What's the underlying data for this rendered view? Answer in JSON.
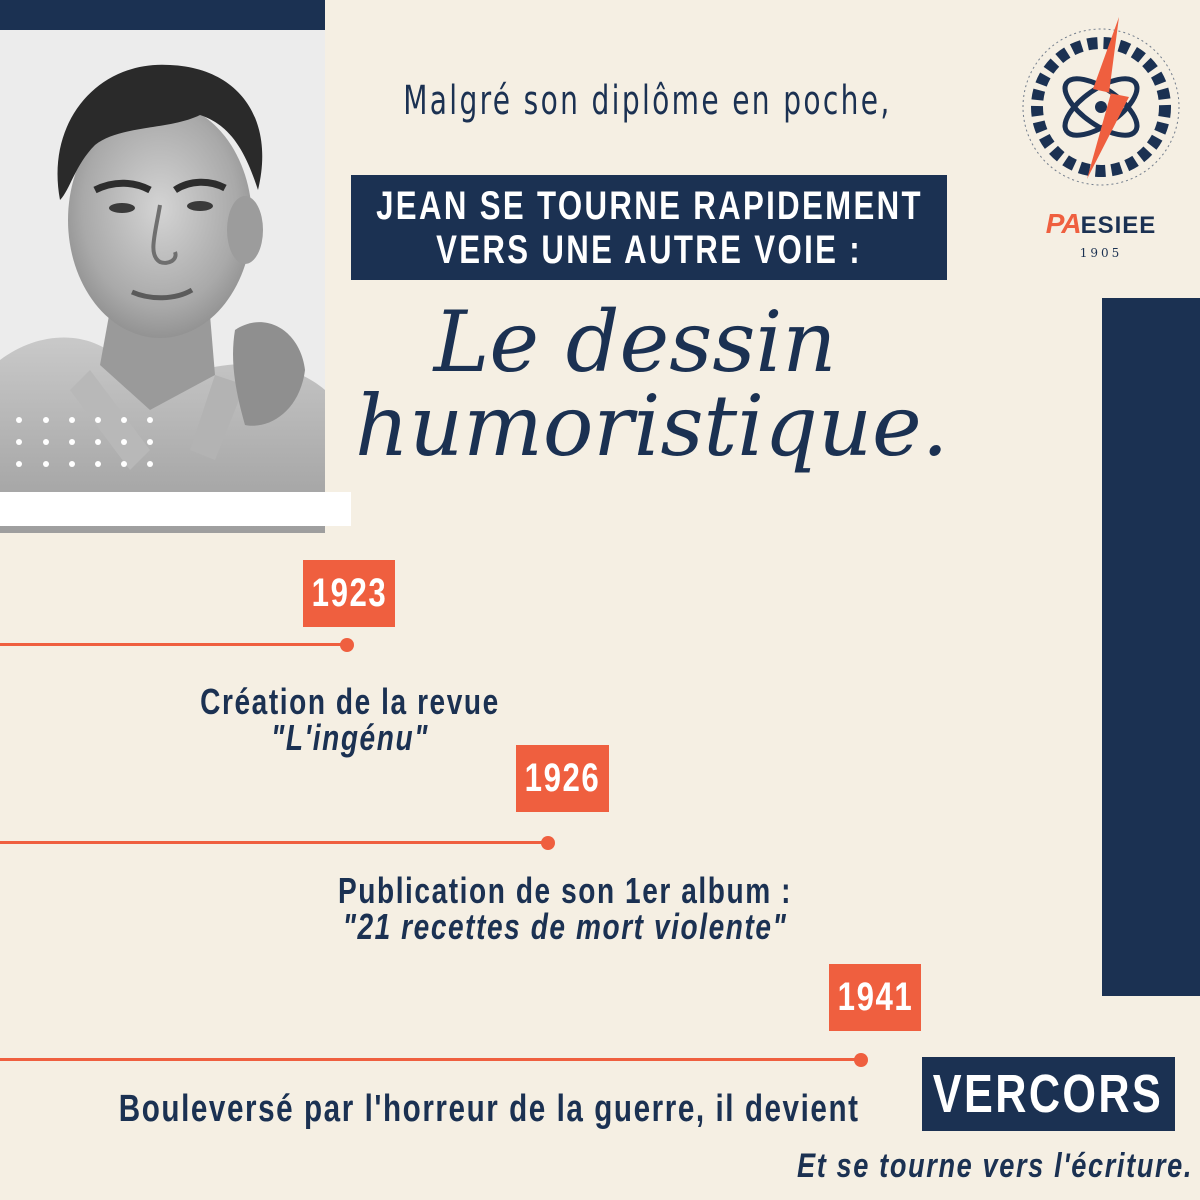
{
  "header": {
    "intro": "Malgré son diplôme en poche,",
    "headline_line1": "JEAN SE TOURNE RAPIDEMENT",
    "headline_line2": "VERS UNE AUTRE VOIE :",
    "script_line1": "Le dessin",
    "script_line2": "humoristique."
  },
  "logo": {
    "brand_prefix": "PA",
    "brand_name": "ESIEE",
    "year": "1905"
  },
  "timeline": [
    {
      "year": "1923",
      "line1": "Création de la revue",
      "line2": "\"L'ingénu\""
    },
    {
      "year": "1926",
      "line1": "Publication de son 1er album :",
      "line2": "\"21 recettes de mort violente\""
    },
    {
      "year": "1941"
    }
  ],
  "footer": {
    "devient_text": "Bouleversé par l'horreur de la guerre, il devient",
    "pseudonym": "VERCORS",
    "ecriture_text": "Et se tourne vers l'écriture."
  },
  "colors": {
    "background": "#f5efe3",
    "navy": "#1b3152",
    "accent": "#ef5f3f"
  }
}
